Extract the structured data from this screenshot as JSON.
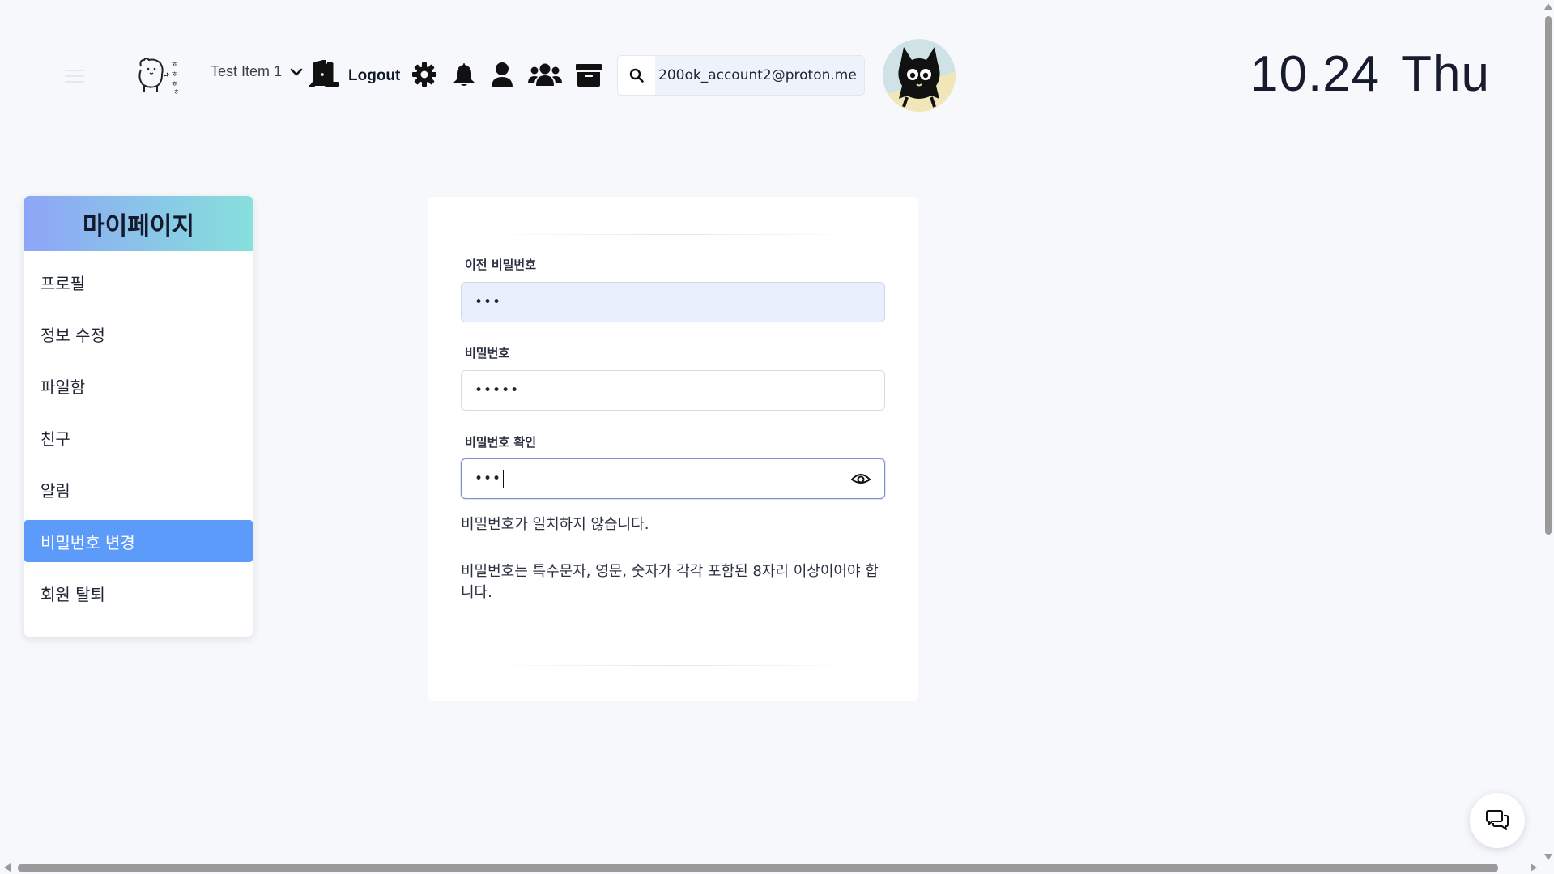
{
  "header": {
    "dropdown_label": "Test Item 1",
    "logout_label": "Logout",
    "search_value": "200ok_account2@proton.me",
    "date_day": "10.24",
    "date_weekday": "Thu",
    "icons": [
      "menu-icon",
      "door-icon",
      "gear-icon",
      "bell-icon",
      "user-icon",
      "users-icon",
      "archive-icon",
      "search-icon"
    ]
  },
  "sidebar": {
    "title": "마이페이지",
    "items": [
      {
        "label": "프로필",
        "active": false
      },
      {
        "label": "정보 수정",
        "active": false
      },
      {
        "label": "파일함",
        "active": false
      },
      {
        "label": "친구",
        "active": false
      },
      {
        "label": "알림",
        "active": false
      },
      {
        "label": "비밀번호 변경",
        "active": true
      },
      {
        "label": "회원 탈퇴",
        "active": false
      }
    ]
  },
  "form": {
    "old_password_label": "이전 비밀번호",
    "old_password_value": "•••",
    "new_password_label": "비밀번호",
    "new_password_value": "•••••",
    "confirm_password_label": "비밀번호 확인",
    "confirm_password_value": "•••",
    "mismatch_message": "비밀번호가 일치하지 않습니다.",
    "rule_message": "비밀번호는 특수문자, 영문, 숫자가 각각 포함된 8자리 이상이어야 합니다."
  },
  "colors": {
    "background": "#f6f8fb",
    "active_item": "#5d9bfa",
    "title_gradient_start": "#8ea5f7",
    "title_gradient_end": "#86e0dc",
    "filled_input": "#e8f0fe"
  }
}
